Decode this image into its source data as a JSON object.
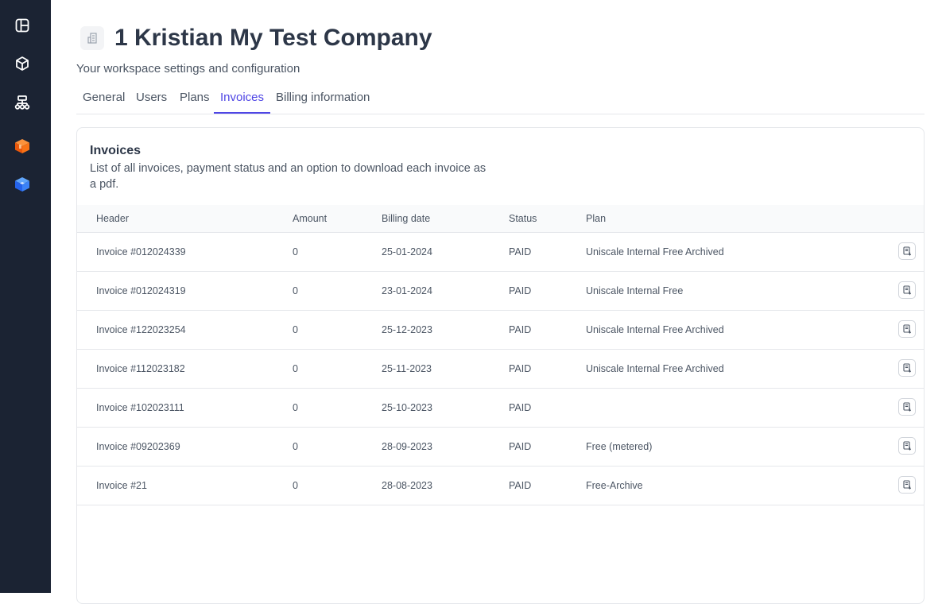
{
  "sidebar": {
    "items": [
      {
        "name": "layout-icon"
      },
      {
        "name": "cube-icon"
      },
      {
        "name": "sitemap-icon"
      },
      {
        "name": "orange-box-logo-icon",
        "color": "#f97316"
      },
      {
        "name": "blue-cube-logo-icon",
        "color": "#3b82f6"
      }
    ]
  },
  "header": {
    "title": "1 Kristian My Test Company",
    "subtitle": "Your workspace settings and configuration"
  },
  "tabs": [
    {
      "label": "General",
      "active": false
    },
    {
      "label": "Users",
      "active": false
    },
    {
      "label": "Plans",
      "active": false
    },
    {
      "label": "Invoices",
      "active": true
    },
    {
      "label": "Billing information",
      "active": false
    }
  ],
  "invoices": {
    "title": "Invoices",
    "description": "List of all invoices, payment status and an option to download each invoice as a pdf.",
    "columns": [
      "Header",
      "Amount",
      "Billing date",
      "Status",
      "Plan"
    ],
    "rows": [
      {
        "header": "Invoice #012024339",
        "amount": "0",
        "date": "25-01-2024",
        "status": "PAID",
        "plan": "Uniscale Internal Free Archived"
      },
      {
        "header": "Invoice #012024319",
        "amount": "0",
        "date": "23-01-2024",
        "status": "PAID",
        "plan": "Uniscale Internal Free"
      },
      {
        "header": "Invoice #122023254",
        "amount": "0",
        "date": "25-12-2023",
        "status": "PAID",
        "plan": "Uniscale Internal Free Archived"
      },
      {
        "header": "Invoice #112023182",
        "amount": "0",
        "date": "25-11-2023",
        "status": "PAID",
        "plan": "Uniscale Internal Free Archived"
      },
      {
        "header": "Invoice #102023111",
        "amount": "0",
        "date": "25-10-2023",
        "status": "PAID",
        "plan": ""
      },
      {
        "header": "Invoice #09202369",
        "amount": "0",
        "date": "28-09-2023",
        "status": "PAID",
        "plan": "Free (metered)"
      },
      {
        "header": "Invoice #21",
        "amount": "0",
        "date": "28-08-2023",
        "status": "PAID",
        "plan": "Free-Archive"
      }
    ]
  },
  "colors": {
    "sidebar_bg": "#1b2333",
    "accent": "#4f46e5",
    "text_dark": "#2d3748"
  }
}
